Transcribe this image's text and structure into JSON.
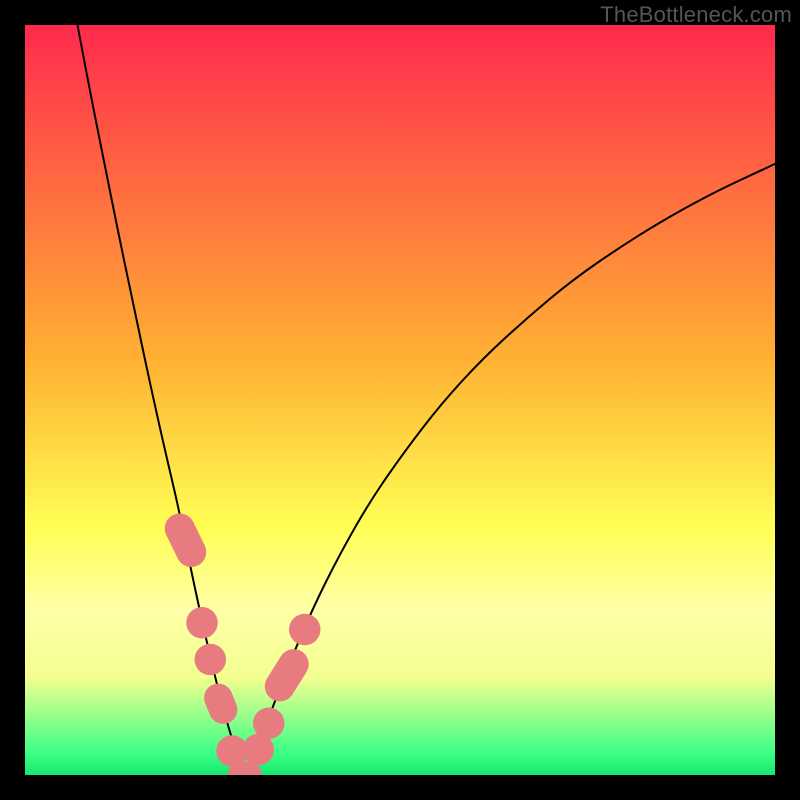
{
  "watermark": "TheBottleneck.com",
  "chart_data": {
    "type": "line",
    "title": "",
    "xlabel": "",
    "ylabel": "",
    "xlim": [
      0,
      100
    ],
    "ylim": [
      0,
      100
    ],
    "gradient_stops": [
      {
        "offset": 0.0,
        "color": "#ff2a4d"
      },
      {
        "offset": 0.45,
        "color": "#ffb233"
      },
      {
        "offset": 0.67,
        "color": "#ffff55"
      },
      {
        "offset": 0.78,
        "color": "#ffffa8"
      },
      {
        "offset": 0.87,
        "color": "#f3ff8f"
      },
      {
        "offset": 0.97,
        "color": "#3dff87"
      },
      {
        "offset": 1.0,
        "color": "#17e86e"
      }
    ],
    "series": [
      {
        "name": "curve-left",
        "values": [
          [
            7.0,
            100.0
          ],
          [
            8.5,
            92.0
          ],
          [
            10.5,
            82.0
          ],
          [
            12.5,
            72.0
          ],
          [
            14.5,
            62.5
          ],
          [
            16.5,
            53.0
          ],
          [
            18.5,
            44.0
          ],
          [
            20.5,
            35.5
          ],
          [
            22.0,
            28.0
          ],
          [
            23.5,
            21.0
          ],
          [
            25.0,
            14.5
          ],
          [
            26.5,
            8.5
          ],
          [
            28.0,
            3.5
          ],
          [
            29.3,
            0.0
          ]
        ]
      },
      {
        "name": "curve-right",
        "values": [
          [
            29.3,
            0.0
          ],
          [
            31.0,
            3.5
          ],
          [
            33.0,
            9.0
          ],
          [
            35.5,
            15.5
          ],
          [
            38.5,
            22.5
          ],
          [
            42.0,
            29.5
          ],
          [
            46.0,
            36.5
          ],
          [
            50.5,
            43.0
          ],
          [
            55.5,
            49.5
          ],
          [
            61.0,
            55.5
          ],
          [
            67.0,
            61.0
          ],
          [
            73.0,
            66.0
          ],
          [
            79.5,
            70.5
          ],
          [
            86.0,
            74.5
          ],
          [
            92.5,
            78.0
          ],
          [
            99.0,
            81.0
          ],
          [
            100.0,
            81.5
          ]
        ]
      }
    ],
    "markers": {
      "name": "highlight-markers",
      "color": "#e77b7f",
      "shapes": [
        {
          "type": "cap",
          "x": 21.4,
          "y": 31.3,
          "len": 7.5,
          "angle": 64,
          "w": 4.0
        },
        {
          "type": "round",
          "x": 23.6,
          "y": 20.3,
          "r": 2.1
        },
        {
          "type": "round",
          "x": 24.7,
          "y": 15.4,
          "r": 2.1
        },
        {
          "type": "cap",
          "x": 26.1,
          "y": 9.5,
          "len": 5.5,
          "angle": 68,
          "w": 3.8
        },
        {
          "type": "round",
          "x": 27.6,
          "y": 3.2,
          "r": 2.1
        },
        {
          "type": "cap",
          "x": 29.3,
          "y": 0.0,
          "len": 4.5,
          "angle": 0,
          "w": 3.6
        },
        {
          "type": "round",
          "x": 31.1,
          "y": 3.4,
          "r": 2.1
        },
        {
          "type": "round",
          "x": 32.5,
          "y": 6.9,
          "r": 2.1
        },
        {
          "type": "cap",
          "x": 34.9,
          "y": 13.3,
          "len": 7.5,
          "angle": -58,
          "w": 4.0
        },
        {
          "type": "round",
          "x": 37.3,
          "y": 19.4,
          "r": 2.1
        }
      ]
    }
  }
}
